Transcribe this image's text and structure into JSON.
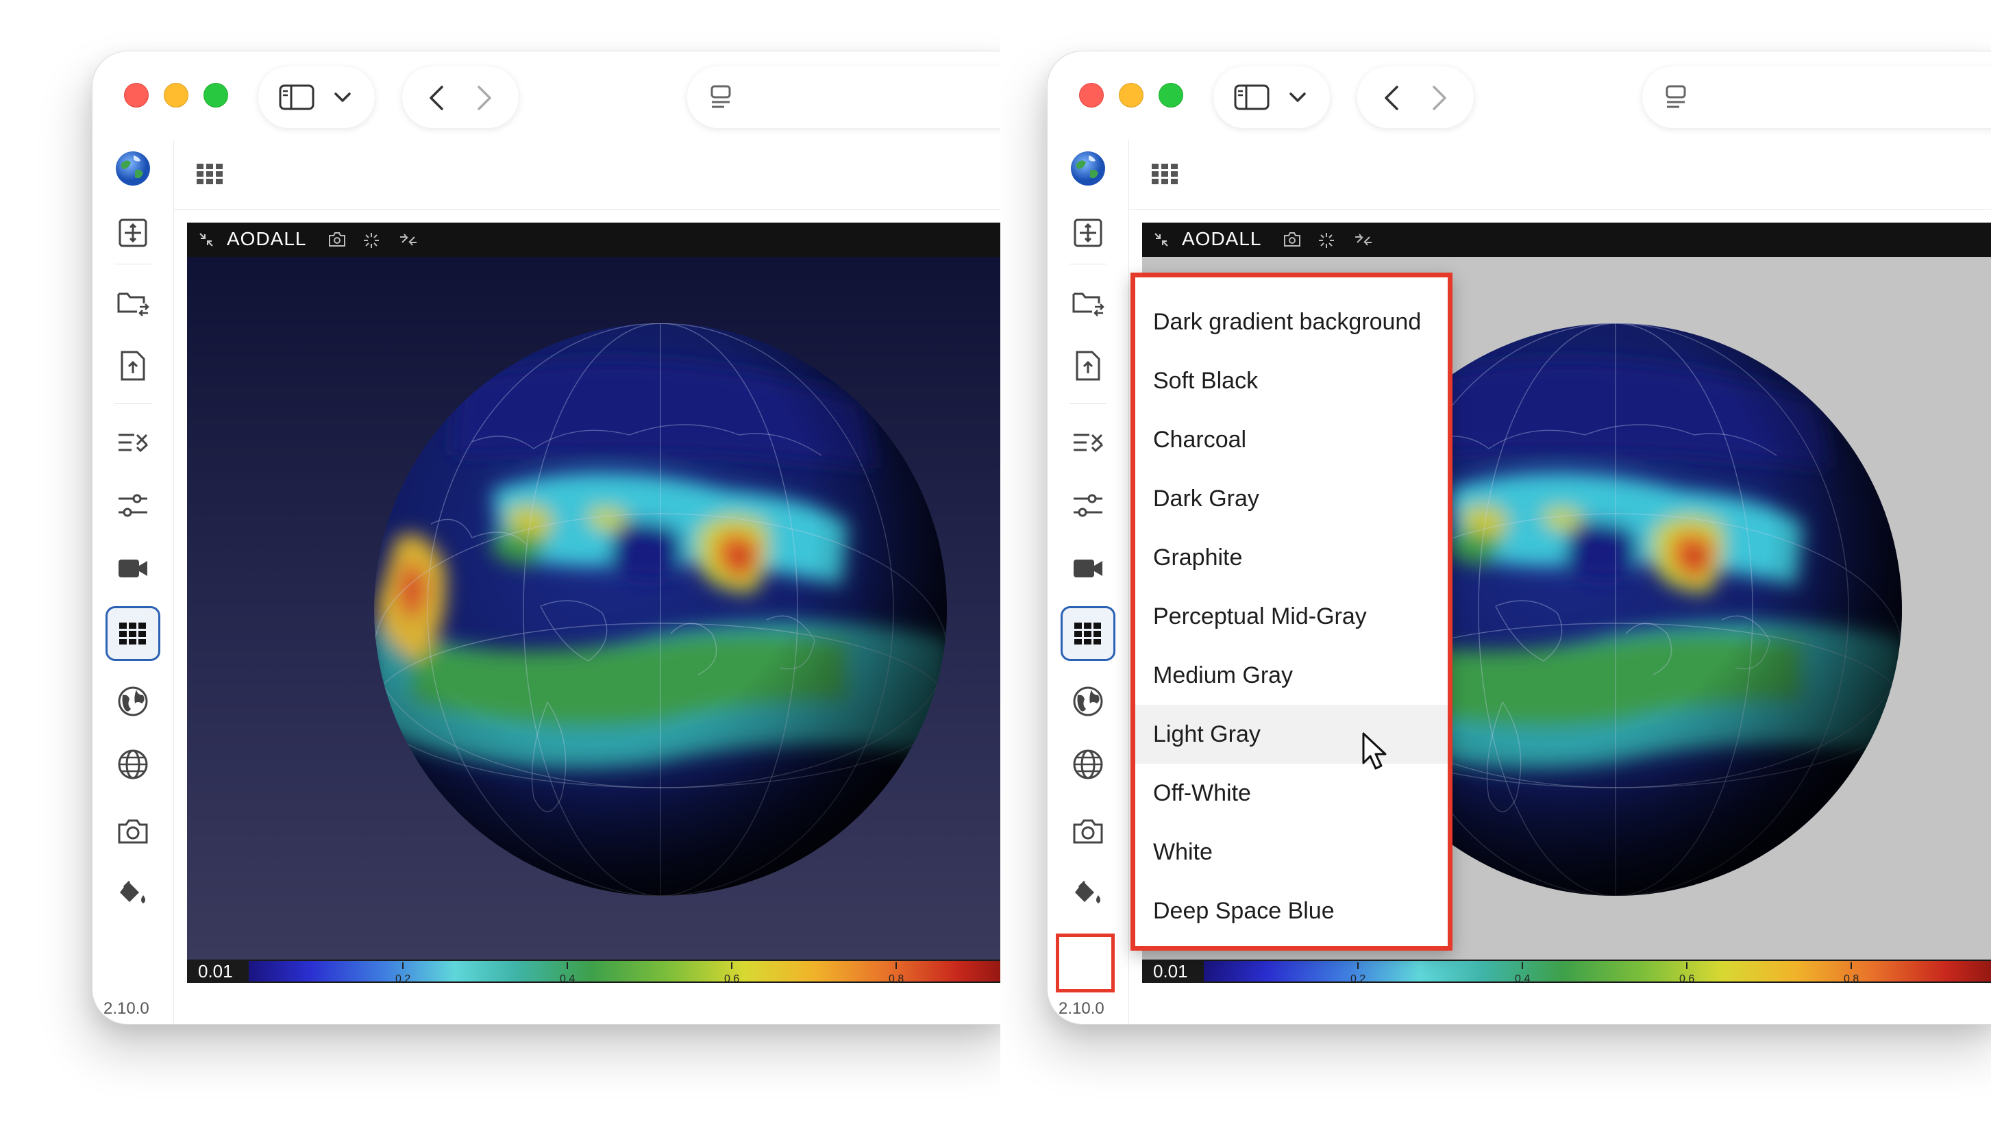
{
  "colors": {
    "window_bg": "#ffffff",
    "close": "#fe5f57",
    "minimize": "#febc2e",
    "zoom": "#28c840",
    "active_outline": "#2c62b4",
    "highlight": "#e5392a",
    "viewer_bar": "#121212",
    "canvas_dark_top": "#0f1235",
    "canvas_light": "#c4c4c4"
  },
  "left": {
    "layer_title": "AODALL",
    "version": "2.10.0",
    "colorbar": {
      "min_label": "0.01",
      "ticks": [
        "0.2",
        "0.4",
        "0.6",
        "0.8"
      ]
    },
    "background": "dark-gradient"
  },
  "right": {
    "layer_title": "AODALL",
    "version": "2.10.0",
    "colorbar": {
      "min_label": "0.01",
      "ticks": [
        "0.2",
        "0.4",
        "0.6",
        "0.8"
      ]
    },
    "background": "light-gray",
    "background_menu": {
      "items": [
        "Dark gradient background",
        "Soft Black",
        "Charcoal",
        "Dark Gray",
        "Graphite",
        "Perceptual Mid-Gray",
        "Medium Gray",
        "Light Gray",
        "Off-White",
        "White",
        "Deep Space Blue"
      ],
      "hovered": "Light Gray"
    }
  },
  "sidebar_icons": [
    "globe-logo-icon",
    "layout-icon",
    "folder-sync-icon",
    "file-upload-icon",
    "checklist-icon",
    "sliders-icon",
    "video-camera-icon",
    "grid-icon",
    "globe-icon",
    "wire-globe-icon",
    "camera-icon",
    "paint-bucket-icon"
  ]
}
